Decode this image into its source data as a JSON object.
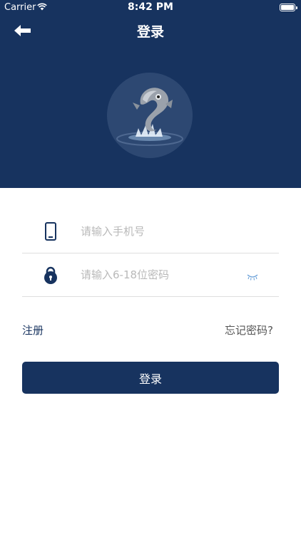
{
  "status_bar": {
    "carrier": "Carrier",
    "time": "8:42 PM"
  },
  "header": {
    "title": "登录",
    "background": "#17335f",
    "back_icon": "arrow-left-icon",
    "logo": "fish-logo"
  },
  "form": {
    "phone": {
      "placeholder": "请输入手机号",
      "icon": "mobile-phone-icon"
    },
    "password": {
      "placeholder": "请输入6-18位密码",
      "icon": "lock-icon",
      "toggle_icon": "eye-closed-icon"
    }
  },
  "links": {
    "register": "注册",
    "forgot": "忘记密码?"
  },
  "button": {
    "login_label": "登录",
    "color": "#17335f"
  }
}
